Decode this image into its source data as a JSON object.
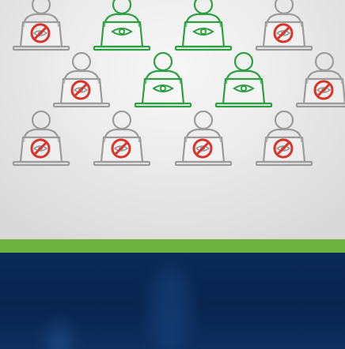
{
  "scene": {
    "colors": {
      "allowed": "#2ea043",
      "blocked_outline": "#9c9c9c",
      "blocked_badge": "#d9342b",
      "stripe": "#6db33f",
      "panel_dark": "#0b2a57"
    },
    "figures": [
      {
        "status": "blocked",
        "icon": "eye-blocked-icon"
      },
      {
        "status": "allowed",
        "icon": "eye-icon"
      },
      {
        "status": "allowed",
        "icon": "eye-icon"
      },
      {
        "status": "blocked",
        "icon": "eye-blocked-icon"
      },
      {
        "status": "blocked",
        "icon": "eye-blocked-icon"
      },
      {
        "status": "allowed",
        "icon": "eye-icon"
      },
      {
        "status": "allowed",
        "icon": "eye-icon"
      },
      {
        "status": "blocked",
        "icon": "eye-blocked-icon"
      },
      {
        "status": "blocked",
        "icon": "eye-blocked-icon"
      },
      {
        "status": "blocked",
        "icon": "eye-blocked-icon"
      },
      {
        "status": "blocked",
        "icon": "eye-blocked-icon"
      },
      {
        "status": "blocked",
        "icon": "eye-blocked-icon"
      }
    ]
  }
}
